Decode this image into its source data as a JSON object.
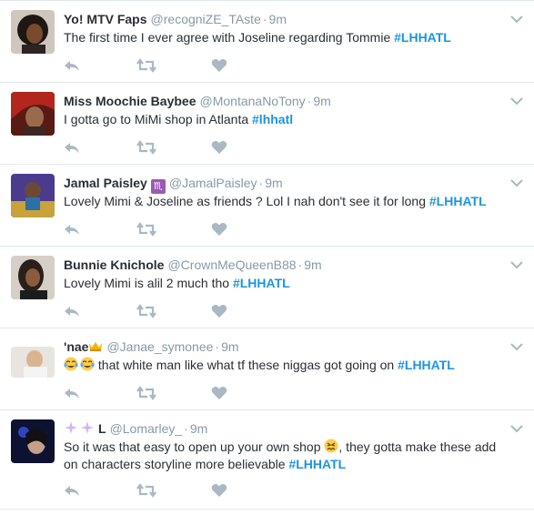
{
  "tweets": [
    {
      "name": "Yo! MTV Faps",
      "handle": "@recogniZE_TAste",
      "time": "9m",
      "text": "The first time I ever agree with Joseline regarding Tommie ",
      "hashtag": "#LHHATL"
    },
    {
      "name": "Miss Moochie Baybee",
      "handle": "@MontanaNoTony",
      "time": "9m",
      "text": "I gotta go to MiMi shop in Atlanta  ",
      "hashtag": "#lhhatl"
    },
    {
      "name": "Jamal Paisley",
      "badge": "♏",
      "handle": "@JamalPaisley",
      "time": "9m",
      "text": "Lovely Mimi & Joseline as friends ? Lol I nah don't see it for long ",
      "hashtag": "#LHHATL"
    },
    {
      "name": "Bunnie Knichole",
      "handle": "@CrownMeQueenB88",
      "time": "9m",
      "text": "Lovely Mimi is alil 2 much tho ",
      "hashtag": "#LHHATL"
    },
    {
      "name": "'nae",
      "name_emoji": "crown-emoji",
      "handle": "@Janae_symonee",
      "time": "9m",
      "text_emoji": "tears-of-joy-emoji",
      "text": " that white man like what tf these niggas got going on ",
      "hashtag": "#LHHATL"
    },
    {
      "name": "L",
      "name_emoji": "sparkles-emoji",
      "handle": "@Lomarley_",
      "time": "9m",
      "text_line1": "So it was that easy to open up your own shop ",
      "text_emoji": "persevering-face-emoji",
      "text_line1b": ", they gotta make these add",
      "text_line2": "on characters storyline more believable  ",
      "hashtag": "#LHHATL"
    }
  ],
  "colors": {
    "hashtag": "#1b95e0",
    "secondary_text": "#8899a6",
    "icon": "#aab8c2",
    "divider": "#e1e8ed",
    "scorpio_badge": "#9b59b6"
  }
}
